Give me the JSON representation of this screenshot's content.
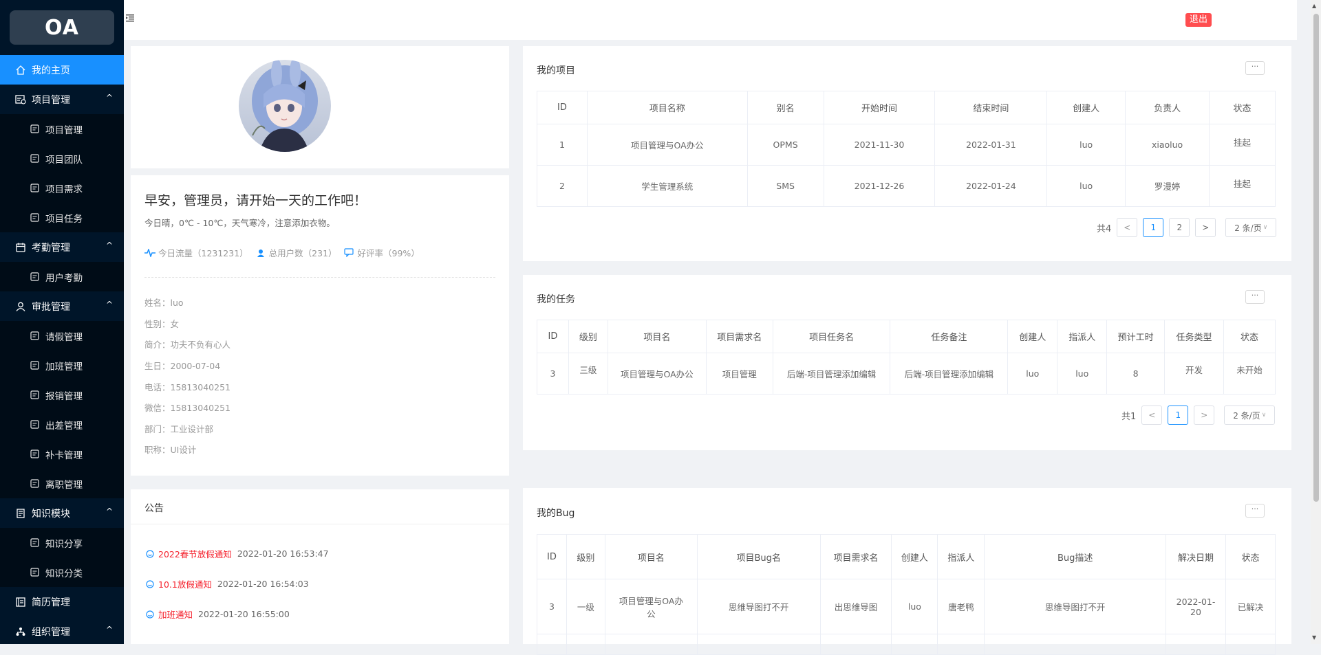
{
  "app": {
    "logo": "OA",
    "logout_label": "退出"
  },
  "sidebar": {
    "items": [
      {
        "label": "我的主页",
        "icon": "home-icon",
        "level": "top",
        "active": true
      },
      {
        "label": "项目管理",
        "icon": "project-icon",
        "level": "top",
        "expanded": true
      },
      {
        "label": "项目管理",
        "icon": "folder-icon",
        "level": "sub"
      },
      {
        "label": "项目团队",
        "icon": "team-icon",
        "level": "sub"
      },
      {
        "label": "项目需求",
        "icon": "chat-icon",
        "level": "sub"
      },
      {
        "label": "项目任务",
        "icon": "task-icon",
        "level": "sub"
      },
      {
        "label": "考勤管理",
        "icon": "calendar-icon",
        "level": "top",
        "expanded": true
      },
      {
        "label": "用户考勤",
        "icon": "calendar-icon",
        "level": "sub"
      },
      {
        "label": "审批管理",
        "icon": "user-icon",
        "level": "top",
        "expanded": true
      },
      {
        "label": "请假管理",
        "icon": "user-gear-icon",
        "level": "sub"
      },
      {
        "label": "加班管理",
        "icon": "overtime-icon",
        "level": "sub"
      },
      {
        "label": "报销管理",
        "icon": "receipt-icon",
        "level": "sub"
      },
      {
        "label": "出差管理",
        "icon": "trip-icon",
        "level": "sub"
      },
      {
        "label": "补卡管理",
        "icon": "card-icon",
        "level": "sub"
      },
      {
        "label": "离职管理",
        "icon": "resign-icon",
        "level": "sub"
      },
      {
        "label": "知识模块",
        "icon": "book-icon",
        "level": "top",
        "expanded": true
      },
      {
        "label": "知识分享",
        "icon": "share-icon",
        "level": "sub"
      },
      {
        "label": "知识分类",
        "icon": "category-icon",
        "level": "sub"
      },
      {
        "label": "简历管理",
        "icon": "resume-icon",
        "level": "top"
      },
      {
        "label": "组织管理",
        "icon": "org-icon",
        "level": "top",
        "expanded": true
      }
    ]
  },
  "profile": {
    "greeting": "早安，管理员，请开始一天的工作吧！",
    "weather": "今日晴，0℃ - 10℃，天气寒冷，注意添加衣物。",
    "stats": [
      {
        "label": "今日流量（1231231）",
        "icon": "pulse-icon"
      },
      {
        "label": "总用户数（231）",
        "icon": "users-icon"
      },
      {
        "label": "好评率（99%）",
        "icon": "comment-icon"
      }
    ],
    "details": [
      "姓名：luo",
      "性别：女",
      "简介：功夫不负有心人",
      "生日：2000-07-04",
      "电话：15813040251",
      "微信：15813040251",
      "部门：工业设计部",
      "职称：UI设计"
    ]
  },
  "notices": {
    "title": "公告",
    "items": [
      {
        "title": "2022春节放假通知",
        "time": "2022-01-20 16:53:47"
      },
      {
        "title": "10.1放假通知",
        "time": "2022-01-20 16:54:03"
      },
      {
        "title": "加班通知",
        "time": "2022-01-20 16:55:00"
      }
    ]
  },
  "projects": {
    "title": "我的项目",
    "more": "···",
    "columns": [
      "ID",
      "项目名称",
      "别名",
      "开始时间",
      "结束时间",
      "创建人",
      "负责人",
      "状态"
    ],
    "rows": [
      [
        "1",
        "项目管理与OA办公",
        "OPMS",
        "2021-11-30",
        "2022-01-31",
        "luo",
        "xiaoluo",
        "挂起"
      ],
      [
        "2",
        "学生管理系统",
        "SMS",
        "2021-12-26",
        "2022-01-24",
        "luo",
        "罗漫婷",
        "挂起"
      ]
    ],
    "pager": {
      "total": "共4",
      "pages": [
        "1",
        "2"
      ],
      "size": "2 条/页"
    }
  },
  "tasks": {
    "title": "我的任务",
    "more": "···",
    "columns": [
      "ID",
      "级别",
      "项目名",
      "项目需求名",
      "项目任务名",
      "任务备注",
      "创建人",
      "指派人",
      "预计工时",
      "任务类型",
      "状态"
    ],
    "rows": [
      [
        "3",
        "三级",
        "项目管理与OA办公",
        "项目管理",
        "后端-项目管理添加编辑",
        "后端-项目管理添加编辑",
        "luo",
        "luo",
        "8",
        "开发",
        "未开始"
      ]
    ],
    "pager": {
      "total": "共1",
      "pages": [
        "1"
      ],
      "size": "2 条/页"
    }
  },
  "bugs": {
    "title": "我的Bug",
    "more": "···",
    "columns": [
      "ID",
      "级别",
      "项目名",
      "项目Bug名",
      "项目需求名",
      "创建人",
      "指派人",
      "Bug描述",
      "解决日期",
      "状态"
    ],
    "rows": [
      [
        "3",
        "一级",
        "项目管理与OA办公",
        "思维导图打不开",
        "出思维导图",
        "luo",
        "唐老鸭",
        "思维导图打不开",
        "2022-01-20",
        "已解决"
      ]
    ]
  }
}
